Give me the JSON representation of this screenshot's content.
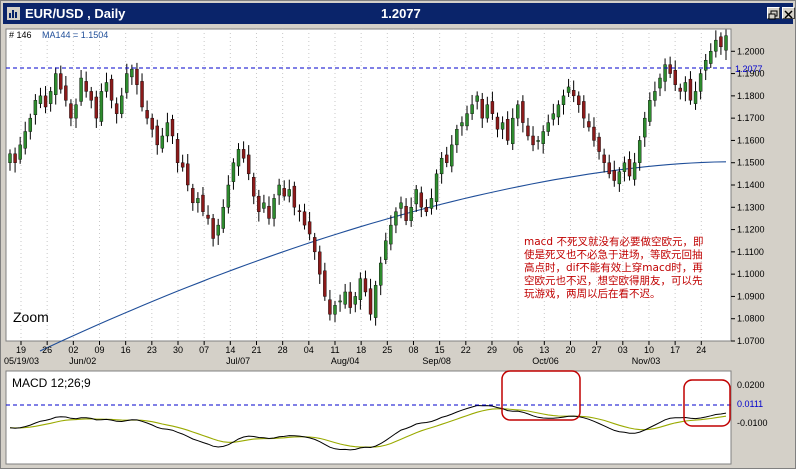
{
  "window": {
    "title": "EUR/USD , Daily",
    "price": "1.2077"
  },
  "price_panel": {
    "bar_label": "# 146",
    "ma_label": "MA144 = 1.1504",
    "current_price_label": "1.2077",
    "zoom_label": "Zoom",
    "annotation": [
      "macd 不死叉就没有必要做空欧元，即",
      "使是死叉也不必急于进场，等欧元回抽",
      "高点时，dif不能有效上穿macd时，再",
      "空欧元也不迟，想空欧得朋友，可以先",
      "玩游戏，两周以后在看不迟。"
    ],
    "y_ticks": [
      "1.2000",
      "1.1900",
      "1.1800",
      "1.1700",
      "1.1600",
      "1.1500",
      "1.1400",
      "1.1300",
      "1.1200",
      "1.1100",
      "1.1000",
      "1.0900",
      "1.0800",
      "1.0700"
    ],
    "x_day_labels": [
      "19",
      "26",
      "02",
      "09",
      "16",
      "23",
      "30",
      "07",
      "14",
      "21",
      "28",
      "04",
      "11",
      "18",
      "25",
      "08",
      "15",
      "22",
      "29",
      "06",
      "13",
      "20",
      "27",
      "03",
      "10",
      "17",
      "24"
    ],
    "x_month_labels": [
      "05/19/03",
      "Jun/02",
      "Jul/07",
      "Aug/04",
      "Sep/08",
      "Oct/06",
      "Nov/03"
    ]
  },
  "macd_panel": {
    "title": "MACD 12;26;9",
    "y_ticks": [
      "0.0200",
      "0.0111",
      "-0.0100"
    ]
  },
  "colors": {
    "up_candle": "#2e8b2e",
    "down_candle": "#8b1a1a",
    "ma_line": "#1f4e99",
    "dif_line": "#000000",
    "signal_line": "#9aaa00",
    "dashed_line": "#0000cc",
    "annotation": "#c00000",
    "highlight": "#c00000"
  },
  "chart_data": [
    {
      "type": "candlestick",
      "title": "EUR/USD , Daily",
      "ylim": [
        1.07,
        1.21
      ],
      "note": "approximate daily closes read from the chart",
      "closes": [
        1.154,
        1.15,
        1.158,
        1.164,
        1.17,
        1.178,
        1.18,
        1.175,
        1.182,
        1.19,
        1.183,
        1.178,
        1.17,
        1.176,
        1.188,
        1.182,
        1.178,
        1.17,
        1.182,
        1.186,
        1.178,
        1.172,
        1.18,
        1.19,
        1.192,
        1.185,
        1.175,
        1.17,
        1.165,
        1.158,
        1.162,
        1.168,
        1.162,
        1.15,
        1.148,
        1.14,
        1.132,
        1.134,
        1.128,
        1.125,
        1.116,
        1.122,
        1.13,
        1.14,
        1.15,
        1.156,
        1.152,
        1.145,
        1.135,
        1.128,
        1.132,
        1.125,
        1.134,
        1.14,
        1.135,
        1.138,
        1.13,
        1.128,
        1.122,
        1.118,
        1.11,
        1.1,
        1.09,
        1.082,
        1.086,
        1.088,
        1.092,
        1.085,
        1.09,
        1.098,
        1.092,
        1.082,
        1.095,
        1.105,
        1.115,
        1.122,
        1.128,
        1.132,
        1.124,
        1.13,
        1.138,
        1.13,
        1.128,
        1.134,
        1.145,
        1.152,
        1.15,
        1.158,
        1.165,
        1.168,
        1.172,
        1.176,
        1.18,
        1.17,
        1.176,
        1.172,
        1.165,
        1.168,
        1.16,
        1.17,
        1.176,
        1.168,
        1.162,
        1.158,
        1.16,
        1.164,
        1.168,
        1.172,
        1.176,
        1.18,
        1.184,
        1.18,
        1.176,
        1.17,
        1.166,
        1.16,
        1.155,
        1.15,
        1.145,
        1.142,
        1.146,
        1.15,
        1.144,
        1.15,
        1.16,
        1.17,
        1.178,
        1.182,
        1.188,
        1.194,
        1.19,
        1.185,
        1.182,
        1.186,
        1.178,
        1.182,
        1.19,
        1.196,
        1.2,
        1.205,
        1.202,
        1.207
      ],
      "ma144_last": 1.1504,
      "last_price": 1.2077
    },
    {
      "type": "line",
      "title": "MACD 12;26;9",
      "ylim": [
        -0.014,
        0.022
      ],
      "current_value": 0.0111
    }
  ]
}
